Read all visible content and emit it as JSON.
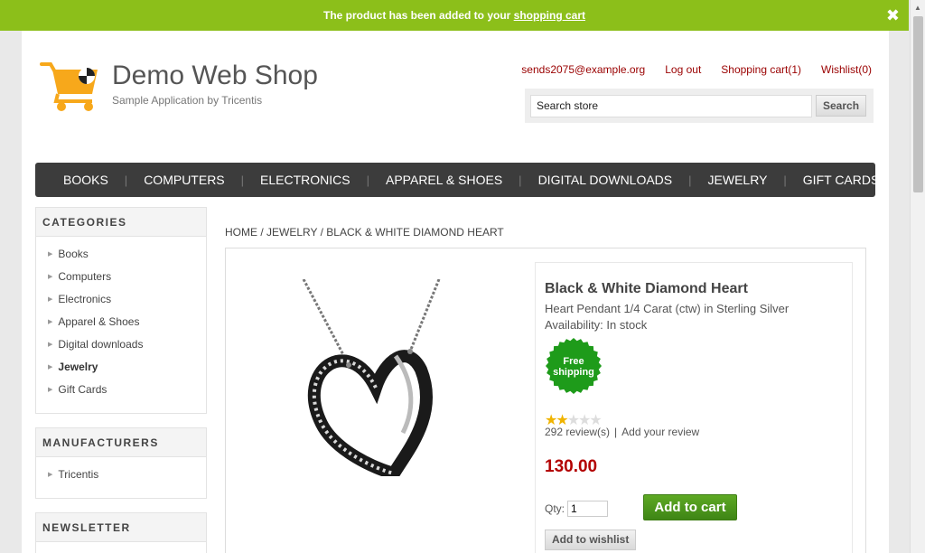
{
  "notification": {
    "text": "The product has been added to your ",
    "link": "shopping cart",
    "close": "✖"
  },
  "header": {
    "logo_title": "Demo Web Shop",
    "logo_subtitle": "Sample Application by Tricentis",
    "links": {
      "account": "sends2075@example.org",
      "logout": "Log out",
      "cart": "Shopping cart(1)",
      "wishlist": "Wishlist(0)"
    },
    "search": {
      "value": "Search store",
      "button": "Search"
    }
  },
  "topmenu": [
    "BOOKS",
    "COMPUTERS",
    "ELECTRONICS",
    "APPAREL & SHOES",
    "DIGITAL DOWNLOADS",
    "JEWELRY",
    "GIFT CARDS"
  ],
  "sidebar": {
    "categories_title": "CATEGORIES",
    "categories": [
      "Books",
      "Computers",
      "Electronics",
      "Apparel & Shoes",
      "Digital downloads",
      "Jewelry",
      "Gift Cards"
    ],
    "manufacturers_title": "MANUFACTURERS",
    "manufacturers": [
      "Tricentis"
    ],
    "newsletter_title": "NEWSLETTER"
  },
  "breadcrumb": {
    "home": "HOME",
    "category": "JEWELRY",
    "current": "BLACK & WHITE DIAMOND HEART",
    "sep": " / "
  },
  "product": {
    "name": "Black & White Diamond Heart",
    "short_description": "Heart Pendant 1/4 Carat (ctw) in Sterling Silver",
    "availability": "Availability: In stock",
    "free_shipping_line1": "Free",
    "free_shipping_line2": "shipping",
    "rating_stars": 2,
    "rating_max": 5,
    "reviews": "292 review(s)",
    "reviews_sep": "|",
    "add_review": "Add your review",
    "price": "130.00",
    "qty_label": "Qty:",
    "qty_value": "1",
    "add_to_cart": "Add to cart",
    "add_to_wishlist": "Add to wishlist"
  },
  "colors": {
    "notification_bg": "#8cbf1a",
    "accent_link": "#9a0000",
    "price": "#b30000",
    "add_to_cart_bg": "#4a9a1c",
    "menu_bg": "#3c3c3c",
    "logo_orange": "#f7a81b"
  }
}
